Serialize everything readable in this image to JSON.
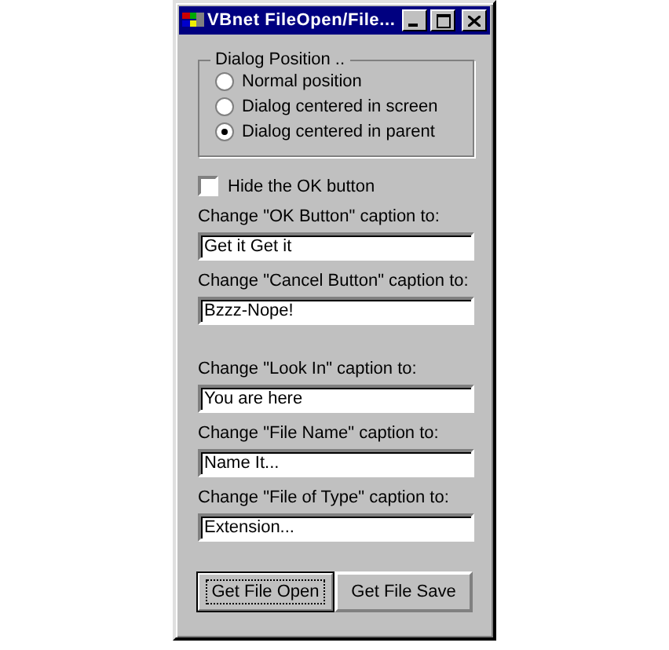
{
  "window": {
    "title": "VBnet FileOpen/File..."
  },
  "dialog_position": {
    "title": "Dialog Position ..",
    "options": [
      {
        "label": "Normal position",
        "selected": false
      },
      {
        "label": "Dialog centered in screen",
        "selected": false
      },
      {
        "label": "Dialog centered in parent",
        "selected": true
      }
    ]
  },
  "hide_ok": {
    "label": "Hide the OK button",
    "checked": false
  },
  "fields": [
    {
      "label": "Change \"OK Button\" caption to:",
      "value": "Get it Get it"
    },
    {
      "label": "Change \"Cancel Button\" caption to:",
      "value": "Bzzz-Nope!"
    },
    {
      "label": "Change \"Look In\" caption to:",
      "value": "You are here"
    },
    {
      "label": "Change \"File Name\" caption to:",
      "value": "Name It..."
    },
    {
      "label": "Change \"File of Type\" caption to:",
      "value": "Extension..."
    }
  ],
  "buttons": [
    {
      "label": "Get File Open",
      "selected": true
    },
    {
      "label": "Get File Save",
      "selected": false
    }
  ]
}
